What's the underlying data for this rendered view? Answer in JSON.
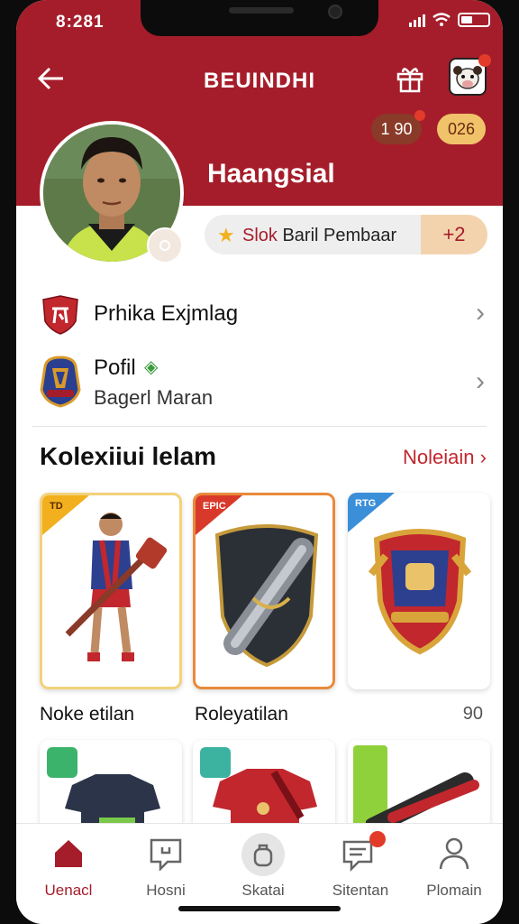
{
  "status_bar": {
    "time": "8:281"
  },
  "header": {
    "title": "BEUINDHI",
    "currency_1": "1 90",
    "currency_2": "026"
  },
  "profile": {
    "username": "Haangsial",
    "status_text_red": "Slok",
    "status_text": "Baril Pembaar",
    "status_badge": "2"
  },
  "menu": [
    {
      "label": "Prhika Exjmlag"
    },
    {
      "label": "Pofil",
      "sublabel": "Bagerl Maran"
    }
  ],
  "collection": {
    "title": "Kolexiiui lelam",
    "see_all": "Noleiain",
    "count": "90",
    "items": [
      {
        "label": "Noke etilan",
        "tag": "TD",
        "tag_color": "#f2b01e",
        "border": "#f2d27a"
      },
      {
        "label": "Roleyatilan",
        "tag": "EPIC",
        "tag_color": "#d9392b",
        "border": "#e98a3a"
      },
      {
        "label": "",
        "tag": "RTG",
        "tag_color": "#3b8ed8",
        "border": "#e6e6e6"
      }
    ]
  },
  "bottom_nav": [
    {
      "label": "Uenacl",
      "icon": "home-icon",
      "active": true
    },
    {
      "label": "Hosni",
      "icon": "chat-icon",
      "active": false
    },
    {
      "label": "Skatai",
      "icon": "shop-icon",
      "active": false
    },
    {
      "label": "Sitentan",
      "icon": "message-icon",
      "active": false
    },
    {
      "label": "Plomain",
      "icon": "profile-icon",
      "active": false
    }
  ],
  "colors": {
    "primary": "#a51d2a",
    "accent": "#c1272d",
    "gold": "#f0c36a"
  }
}
